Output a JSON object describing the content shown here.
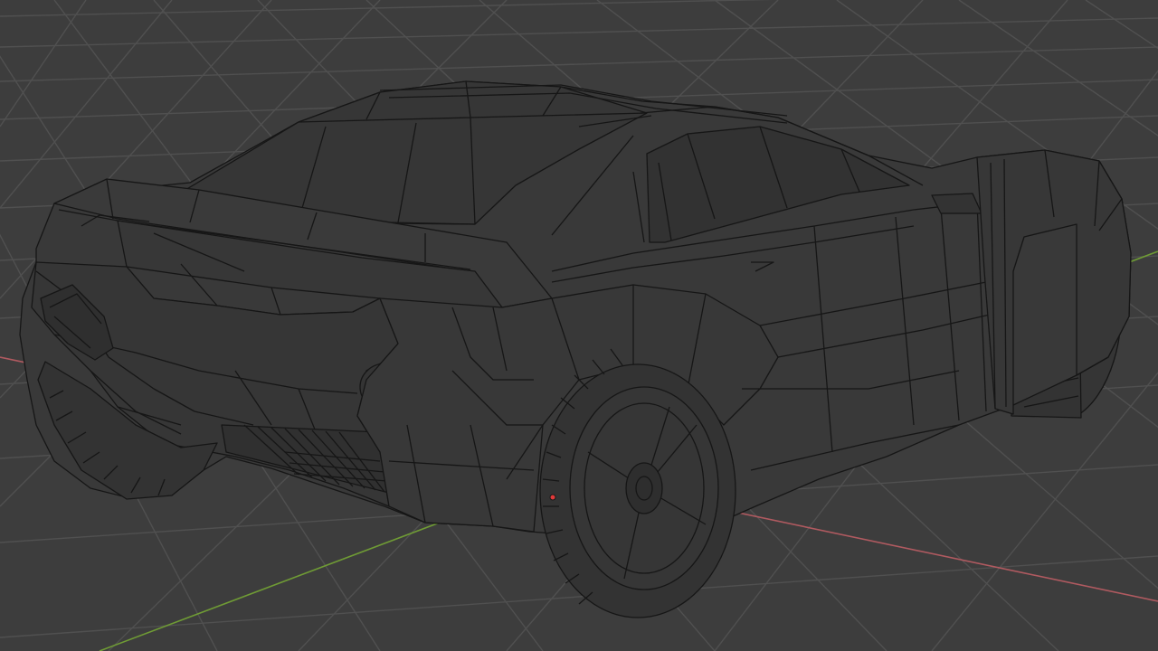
{
  "viewport": {
    "kind": "3d-viewport-wireframe",
    "shading": "wireframe",
    "object": "sports-car",
    "view": "rear-three-quarter",
    "colors": {
      "background": "#3d3d3d",
      "grid_minor": "#505050",
      "grid_major": "#5a5a5a",
      "x_axis": "#b05a60",
      "y_axis": "#6f9b35",
      "wire": "#161616",
      "body_face": "#393939",
      "origin": "#e23a3a"
    }
  }
}
